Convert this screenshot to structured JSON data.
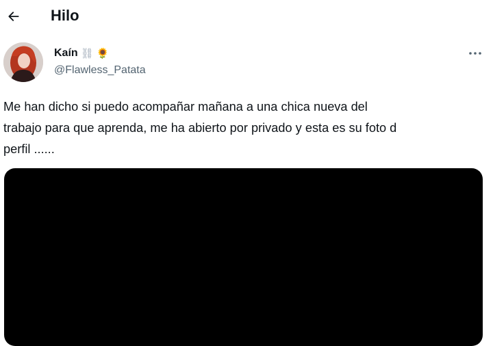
{
  "header": {
    "title": "Hilo",
    "back_icon": "arrow-left-icon"
  },
  "tweet": {
    "author": {
      "name": "Kaín",
      "badges": [
        "⛓",
        "🌻"
      ],
      "handle": "@Flawless_Patata",
      "avatar_icon": "avatar-photo"
    },
    "more_icon": "more-horizontal-icon",
    "text": "Me han dicho si puedo acompañar mañana a una chica nueva del\ntrabajo para que aprenda, me ha abierto por privado y esta es su foto d\nperfil ......",
    "media_color": "#000000"
  },
  "colors": {
    "text_primary": "#0f1419",
    "text_secondary": "#536471",
    "background": "#ffffff"
  }
}
